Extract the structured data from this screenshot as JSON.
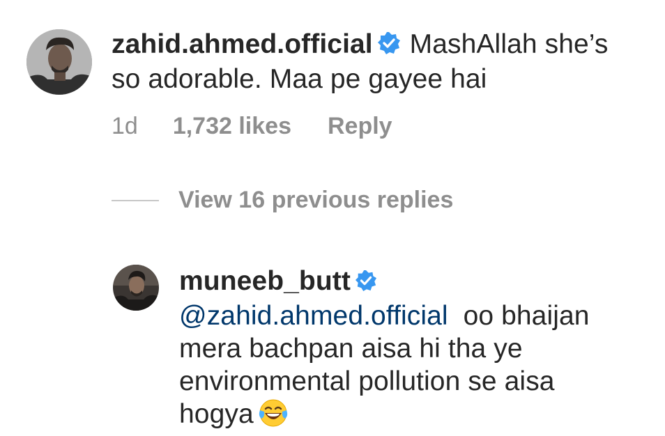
{
  "comment": {
    "username": "zahid.ahmed.official",
    "verified": true,
    "text_line1": "MashAllah she’s",
    "text_line2": "so adorable. Maa pe gayee hai",
    "time": "1d",
    "likes": "1,732 likes",
    "reply_label": "Reply"
  },
  "view_replies": {
    "label": "View 16 previous replies"
  },
  "reply": {
    "username": "muneeb_butt",
    "verified": true,
    "mention": "@zahid.ahmed.official",
    "text_line1_rest": "oo bhaijan",
    "text_line2": "mera bachpan aisa hi tha ye",
    "text_line3": "environmental pollution se aisa",
    "text_line4": "hogya",
    "emoji": "face-with-tears-of-joy"
  },
  "colors": {
    "text": "#262626",
    "secondary": "#8e8e8e",
    "mention": "#00376b",
    "verified_badge": "#3897f0"
  }
}
